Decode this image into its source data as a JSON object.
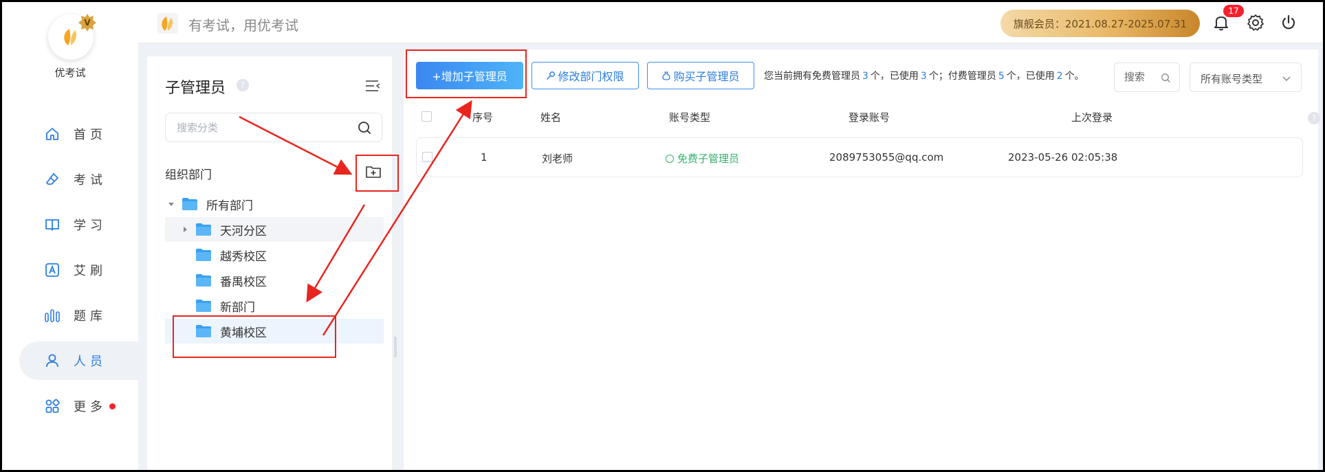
{
  "app": {
    "name": "优考试",
    "slogan": "有考试，用优考试",
    "vip_badge_letter": "V"
  },
  "nav": {
    "items": [
      {
        "key": "home",
        "label": "首页",
        "icon": "home-icon"
      },
      {
        "key": "exam",
        "label": "考试",
        "icon": "eraser-icon"
      },
      {
        "key": "study",
        "label": "学习",
        "icon": "book-icon"
      },
      {
        "key": "aishua",
        "label": "艾刷",
        "icon": "letter-a-icon"
      },
      {
        "key": "bank",
        "label": "题库",
        "icon": "bars-icon"
      },
      {
        "key": "people",
        "label": "人员",
        "icon": "person-icon",
        "active": true
      },
      {
        "key": "more",
        "label": "更多",
        "icon": "apps-icon",
        "dot": true
      }
    ]
  },
  "topbar": {
    "vip_text": "旗舰会员：2021.08.27-2025.07.31",
    "notification_count": "17"
  },
  "dept_panel": {
    "title": "子管理员",
    "help": "?",
    "search_placeholder": "搜索分类",
    "section_label": "组织部门",
    "tree": [
      {
        "label": "所有部门",
        "level": 0,
        "expanded": true
      },
      {
        "label": "天河分区",
        "level": 1,
        "collapsed_caret": true,
        "hover": true
      },
      {
        "label": "越秀校区",
        "level": 1
      },
      {
        "label": "番禺校区",
        "level": 1
      },
      {
        "label": "新部门",
        "level": 1
      },
      {
        "label": "黄埔校区",
        "level": 1,
        "selected": true
      }
    ]
  },
  "toolbar": {
    "add_label": "+增加子管理员",
    "edit_perm_label": "修改部门权限",
    "buy_label": "购买子管理员",
    "quota": {
      "p1": "您当前拥有免费管理员",
      "free_total": "3",
      "p2": "个，已使用",
      "free_used": "3",
      "p3": "个；付费管理员",
      "paid_total": "5",
      "p4": "个，已使用",
      "paid_used": "2",
      "p5": "个。"
    },
    "search_placeholder": "搜索",
    "type_select": "所有账号类型"
  },
  "table": {
    "columns": [
      "序号",
      "姓名",
      "账号类型",
      "登录账号",
      "上次登录"
    ],
    "rows": [
      {
        "index": "1",
        "name": "刘老师",
        "type": "免费子管理员",
        "account": "2089753055@qq.com",
        "last_login": "2023-05-26 02:05:38"
      }
    ]
  },
  "colors": {
    "accent": "#2b7de1",
    "annotation_red": "#e8251f",
    "status_green": "#35b06b",
    "vip_gold": "#e9b866"
  }
}
